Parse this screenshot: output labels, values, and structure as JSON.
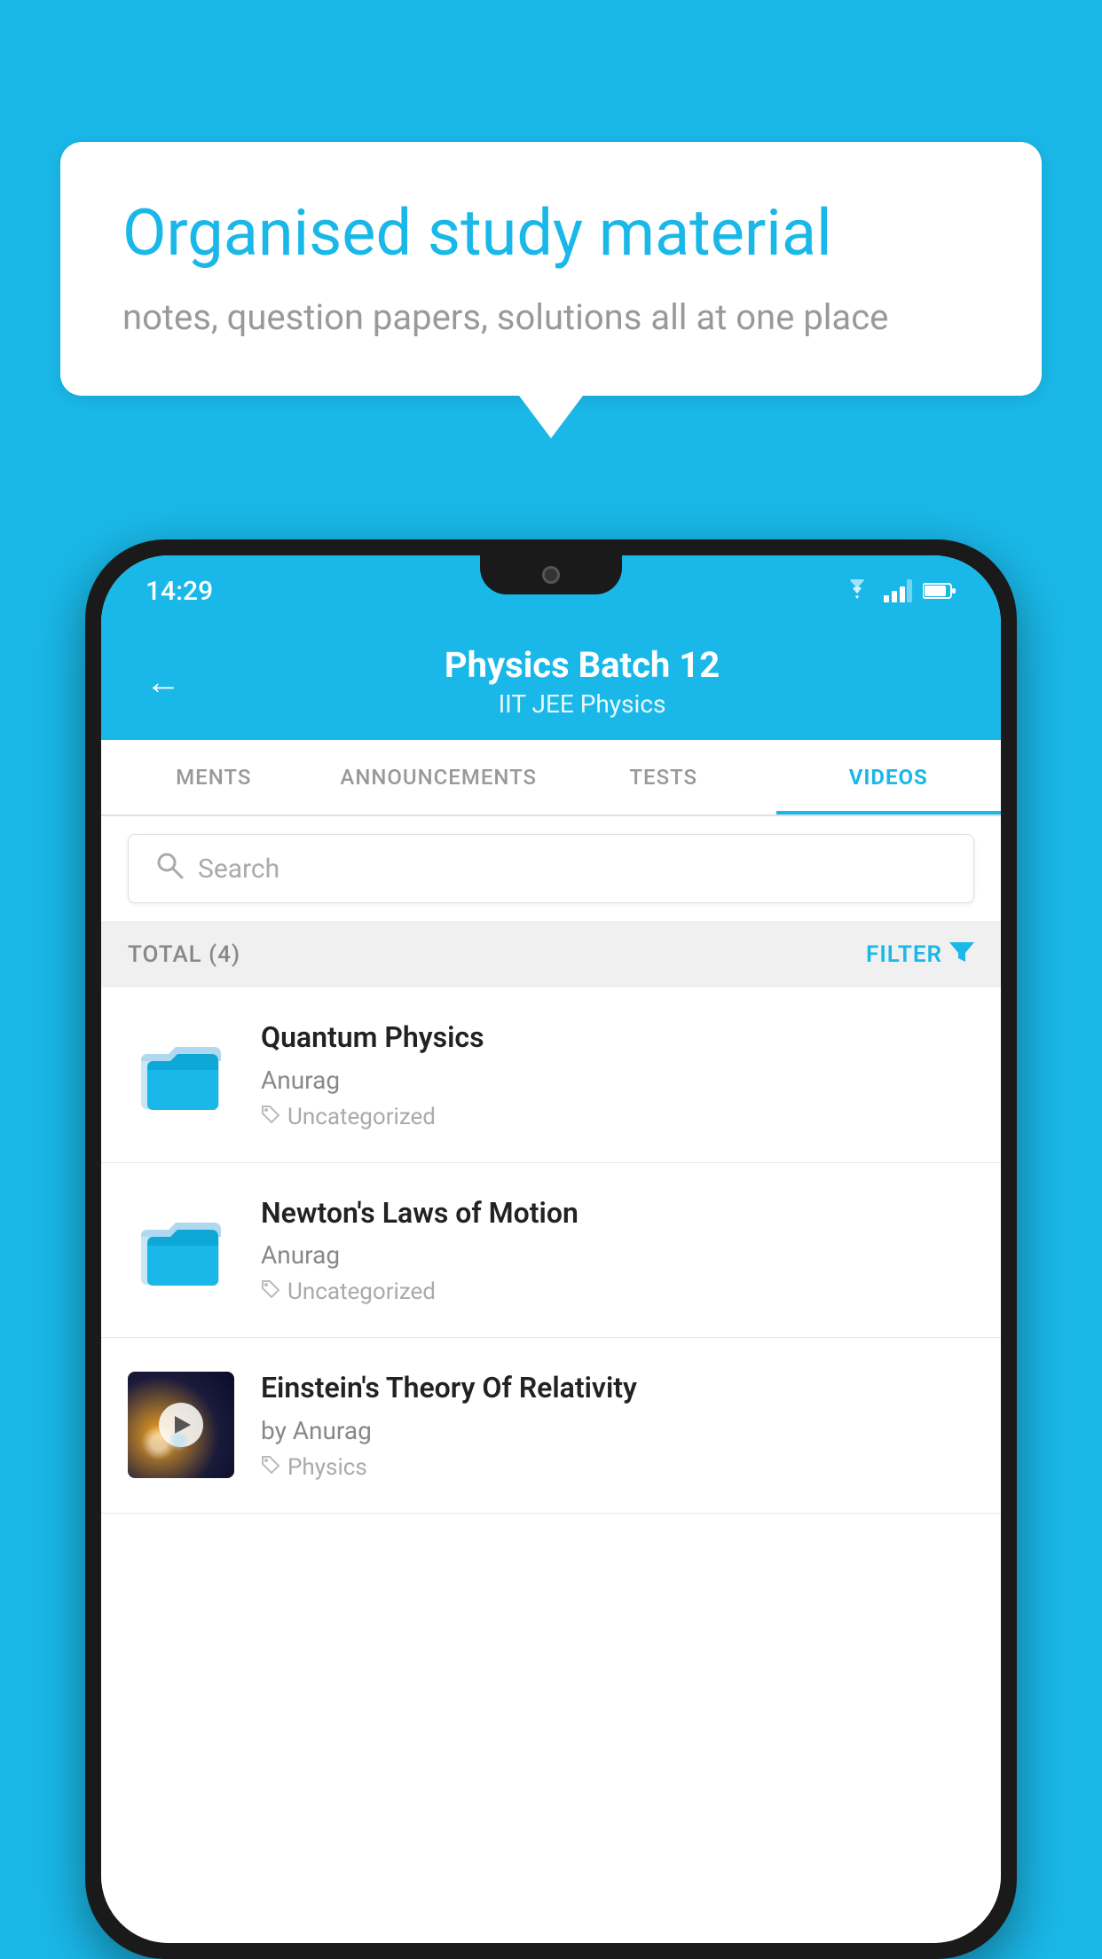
{
  "background_color": "#1ab8e8",
  "speech_bubble": {
    "title": "Organised study material",
    "subtitle": "notes, question papers, solutions all at one place"
  },
  "phone": {
    "status_bar": {
      "time": "14:29",
      "icons": [
        "wifi",
        "signal",
        "battery"
      ]
    },
    "header": {
      "back_label": "←",
      "title": "Physics Batch 12",
      "subtitle": "IIT JEE   Physics"
    },
    "tabs": [
      {
        "label": "MENTS",
        "active": false
      },
      {
        "label": "ANNOUNCEMENTS",
        "active": false
      },
      {
        "label": "TESTS",
        "active": false
      },
      {
        "label": "VIDEOS",
        "active": true
      }
    ],
    "search": {
      "placeholder": "Search"
    },
    "filter_bar": {
      "total_label": "TOTAL (4)",
      "filter_label": "FILTER"
    },
    "videos": [
      {
        "title": "Quantum Physics",
        "author": "Anurag",
        "tag": "Uncategorized",
        "type": "folder"
      },
      {
        "title": "Newton's Laws of Motion",
        "author": "Anurag",
        "tag": "Uncategorized",
        "type": "folder"
      },
      {
        "title": "Einstein's Theory Of Relativity",
        "author": "by Anurag",
        "tag": "Physics",
        "type": "video"
      }
    ]
  }
}
